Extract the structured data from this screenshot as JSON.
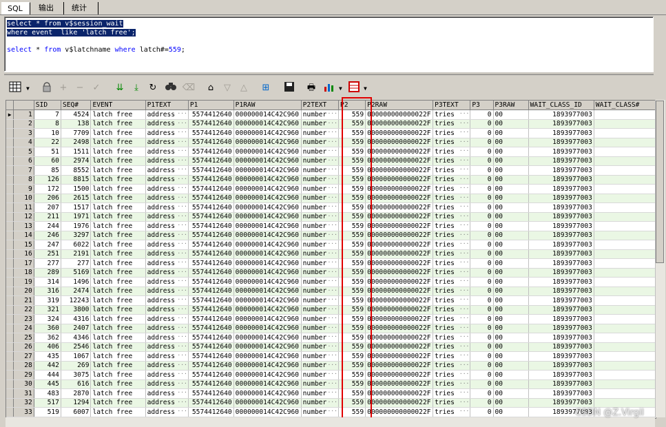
{
  "tabs": [
    {
      "label": "SQL"
    },
    {
      "label": "输出"
    },
    {
      "label": "统计"
    }
  ],
  "editor": {
    "line1": "select * from v$session_wait",
    "line2": "where event  like 'latch free';",
    "line3_a": "select",
    "line3_b": " * ",
    "line3_c": "from",
    "line3_d": " v$latchname ",
    "line3_e": "where",
    "line3_f": " latch#=",
    "line3_g": "559",
    "line3_h": ";"
  },
  "toolbar": {
    "icons": [
      "grid-icon",
      "lock-icon",
      "plus-icon",
      "minus-icon",
      "check-icon",
      "down-arrows-icon",
      "down-last-icon",
      "refresh-icon",
      "binoculars-icon",
      "clear-icon",
      "home-icon",
      "filter-down-icon",
      "filter-up-icon",
      "query-icon",
      "save-icon",
      "print-icon",
      "chart-icon",
      "export-icon"
    ]
  },
  "columns": [
    "SID",
    "SEQ#",
    "EVENT",
    "P1TEXT",
    "P1",
    "P1RAW",
    "P2TEXT",
    "P2",
    "P2RAW",
    "P3TEXT",
    "P3",
    "P3RAW",
    "WAIT_CLASS_ID",
    "WAIT_CLASS#"
  ],
  "rows": [
    [
      "1",
      "7",
      "4524"
    ],
    [
      "2",
      "8",
      "138"
    ],
    [
      "3",
      "10",
      "7709"
    ],
    [
      "4",
      "22",
      "2498"
    ],
    [
      "5",
      "51",
      "1511"
    ],
    [
      "6",
      "60",
      "2974"
    ],
    [
      "7",
      "85",
      "8552"
    ],
    [
      "8",
      "126",
      "8815"
    ],
    [
      "9",
      "172",
      "1500"
    ],
    [
      "10",
      "206",
      "2615"
    ],
    [
      "11",
      "207",
      "1517"
    ],
    [
      "12",
      "211",
      "1971"
    ],
    [
      "13",
      "244",
      "1976"
    ],
    [
      "14",
      "246",
      "3297"
    ],
    [
      "15",
      "247",
      "6022"
    ],
    [
      "16",
      "251",
      "2191"
    ],
    [
      "17",
      "277",
      "277"
    ],
    [
      "18",
      "289",
      "5169"
    ],
    [
      "19",
      "314",
      "1496"
    ],
    [
      "20",
      "316",
      "2474"
    ],
    [
      "21",
      "319",
      "12243"
    ],
    [
      "22",
      "321",
      "3800"
    ],
    [
      "23",
      "324",
      "4316"
    ],
    [
      "24",
      "360",
      "2407"
    ],
    [
      "25",
      "362",
      "4346"
    ],
    [
      "26",
      "406",
      "2546"
    ],
    [
      "27",
      "435",
      "1067"
    ],
    [
      "28",
      "442",
      "269"
    ],
    [
      "29",
      "444",
      "3075"
    ],
    [
      "30",
      "445",
      "616"
    ],
    [
      "31",
      "483",
      "2870"
    ],
    [
      "32",
      "517",
      "1294"
    ],
    [
      "33",
      "519",
      "6007"
    ]
  ],
  "common": {
    "event": "latch free",
    "p1text": "address",
    "p1": "5574412640",
    "p1raw": "000000014C42C960",
    "p2text": "number",
    "p2": "559",
    "p2raw": "000000000000022F",
    "p3text": "tries",
    "p3": "0",
    "p3raw": "00",
    "wait_class_id": "1893977003"
  },
  "ellipsis": "···",
  "watermark": "CSDN @Z.Virgil"
}
